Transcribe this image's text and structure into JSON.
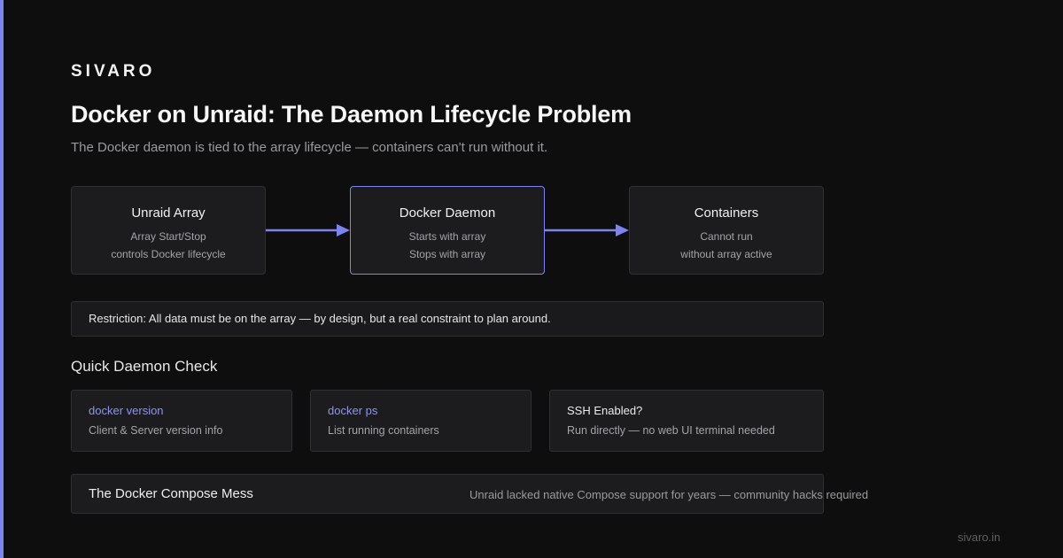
{
  "brand": "SIVARO",
  "title": "Docker on Unraid: The Daemon Lifecycle Problem",
  "subtitle": "The Docker daemon is tied to the array lifecycle — containers can't run without it.",
  "flow": {
    "nodes": [
      {
        "title": "Unraid Array",
        "lines": [
          "Array Start/Stop",
          "controls Docker lifecycle"
        ]
      },
      {
        "title": "Docker Daemon",
        "lines": [
          "Starts with array",
          "Stops with array"
        ]
      },
      {
        "title": "Containers",
        "lines": [
          "Cannot run",
          "without array active"
        ]
      }
    ]
  },
  "restriction": "Restriction: All data must be on the array — by design, but a real constraint to plan around.",
  "check_section": {
    "title": "Quick Daemon Check",
    "cards": [
      {
        "heading": "docker version",
        "desc": "Client & Server version info"
      },
      {
        "heading": "docker ps",
        "desc": "List running containers"
      },
      {
        "heading": "SSH Enabled?",
        "desc": "Run directly — no web UI terminal needed"
      }
    ]
  },
  "compose": {
    "title": "The Docker Compose Mess",
    "note": "Unraid lacked native Compose support for years — community hacks required"
  },
  "footer": "sivaro.in",
  "colors": {
    "accent": "#7b84f0",
    "background": "#0e0e0f",
    "card": "#1c1c1f",
    "border": "#2f2f33"
  }
}
